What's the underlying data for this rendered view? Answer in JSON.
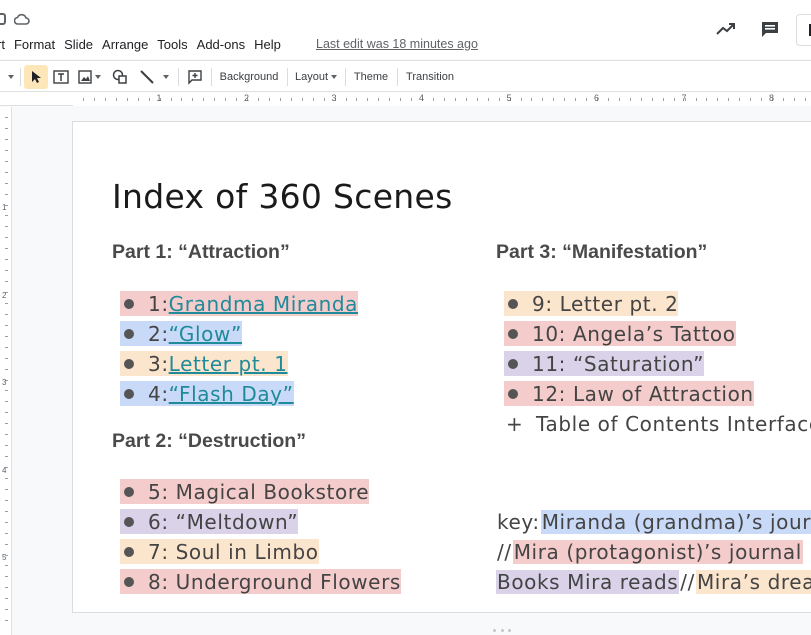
{
  "menu": [
    "rt",
    "Format",
    "Slide",
    "Arrange",
    "Tools",
    "Add-ons",
    "Help"
  ],
  "last_edit": "Last edit was 18 minutes ago",
  "toolbar": {
    "background": "Background",
    "layout": "Layout",
    "theme": "Theme",
    "transition": "Transition"
  },
  "ruler": {
    "h_numbers": [
      "1",
      "2",
      "3",
      "4",
      "5",
      "6",
      "7",
      "8"
    ],
    "v_numbers": [
      "1",
      "2",
      "3",
      "4",
      "5"
    ]
  },
  "slide": {
    "title": "Index of 360 Scenes",
    "part1": {
      "heading": "Part 1: “Attraction”",
      "items": [
        {
          "prefix": "1: ",
          "link": "Grandma Miranda",
          "color": "#f4cccc"
        },
        {
          "prefix": "2: ",
          "link": "“Glow”",
          "color": "#c9daf8"
        },
        {
          "prefix": "3: ",
          "link": "Letter pt. 1",
          "color": "#fce5cd"
        },
        {
          "prefix": "4: ",
          "link": "“Flash Day”",
          "color": "#c9daf8"
        }
      ]
    },
    "part2": {
      "heading": "Part 2: “Destruction”",
      "items": [
        {
          "text": "5: Magical Bookstore",
          "color": "#f4cccc"
        },
        {
          "text": "6: “Meltdown”",
          "color": "#d9d2e9"
        },
        {
          "text": "7: Soul in Limbo",
          "color": "#fce5cd"
        },
        {
          "text": "8: Underground Flowers",
          "color": "#f4cccc"
        }
      ]
    },
    "part3": {
      "heading": "Part 3: “Manifestation”",
      "items": [
        {
          "text": "9: Letter pt. 2",
          "color": "#fce5cd"
        },
        {
          "text": "10: Angela’s Tattoo",
          "color": "#f4cccc"
        },
        {
          "text": "11: “Saturation”",
          "color": "#d9d2e9"
        },
        {
          "text": "12: Law of Attraction",
          "color": "#f4cccc"
        }
      ],
      "extra": "Table of Contents Interface",
      "extra_marker": "+"
    },
    "key": {
      "line1_label": "key: ",
      "line1_hl": "Miranda (grandma)’s journal",
      "line2_sep": "// ",
      "line2_hl": "Mira (protagonist)’s journal",
      "line3_hl": "Books Mira reads",
      "line3_sep": " // ",
      "line3_hl2": "Mira’s dreams"
    }
  },
  "icons": [
    "cloud-icon",
    "trend-icon",
    "comment-icon",
    "cursor-icon",
    "textbox-icon",
    "image-icon",
    "shape-icon",
    "line-icon",
    "add-comment-icon"
  ]
}
